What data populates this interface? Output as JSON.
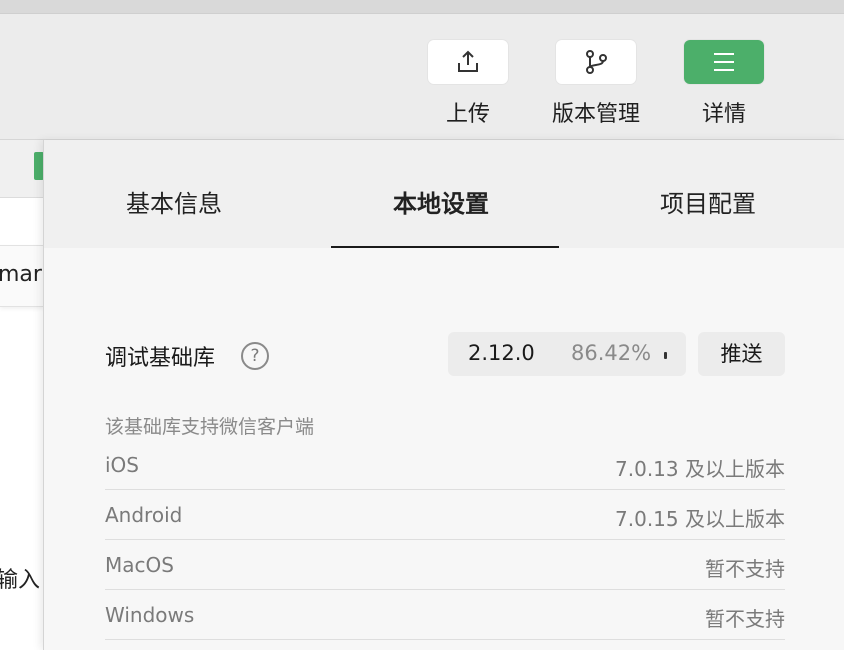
{
  "toolbar": {
    "upload_label": "上传",
    "version_label": "版本管理",
    "details_label": "详情",
    "details_color": "#4caf6a"
  },
  "background": {
    "left_input_text": "mar",
    "left_text": "输入"
  },
  "panel": {
    "tabs": [
      {
        "label": "基本信息",
        "active": false
      },
      {
        "label": "本地设置",
        "active": true
      },
      {
        "label": "项目配置",
        "active": false
      }
    ],
    "debug_lib": {
      "label": "调试基础库",
      "help_icon": "question-circle-icon",
      "version": "2.12.0",
      "percent": "86.42%",
      "push_label": "推送"
    },
    "support": {
      "title": "该基础库支持微信客户端",
      "rows": [
        {
          "name": "iOS",
          "value": "7.0.13 及以上版本"
        },
        {
          "name": "Android",
          "value": "7.0.15 及以上版本"
        },
        {
          "name": "MacOS",
          "value": "暂不支持"
        },
        {
          "name": "Windows",
          "value": "暂不支持"
        }
      ]
    }
  }
}
